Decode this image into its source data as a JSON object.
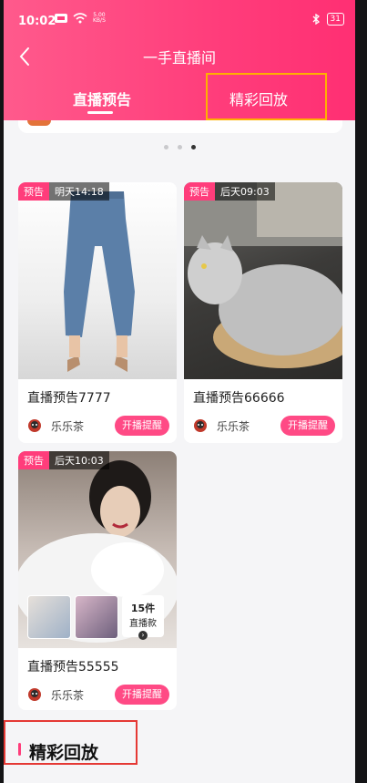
{
  "status_bar": {
    "time": "10:02",
    "net_speed_top": "5.00",
    "net_speed_bottom": "KB/S",
    "battery": "31"
  },
  "header": {
    "title": "一手直播间",
    "tabs": [
      {
        "label": "直播预告",
        "active": true
      },
      {
        "label": "精彩回放",
        "active": false
      }
    ]
  },
  "carousel": {
    "dots": 3,
    "active_index": 2
  },
  "cards": [
    {
      "tag": "预告",
      "time": "明天14:18",
      "title": "直播预告7777",
      "host": "乐乐茶",
      "button": "开播提醒"
    },
    {
      "tag": "预告",
      "time": "后天09:03",
      "title": "直播预告66666",
      "host": "乐乐茶",
      "button": "开播提醒"
    },
    {
      "tag": "预告",
      "time": "后天10:03",
      "title": "直播预告55555",
      "host": "乐乐茶",
      "button": "开播提醒",
      "products": {
        "count": "15件",
        "label": "直播款"
      }
    }
  ],
  "section": {
    "title": "精彩回放"
  },
  "colors": {
    "accent": "#ff3d7b",
    "highlight_box": "#ffb000",
    "section_box": "#e53935"
  }
}
